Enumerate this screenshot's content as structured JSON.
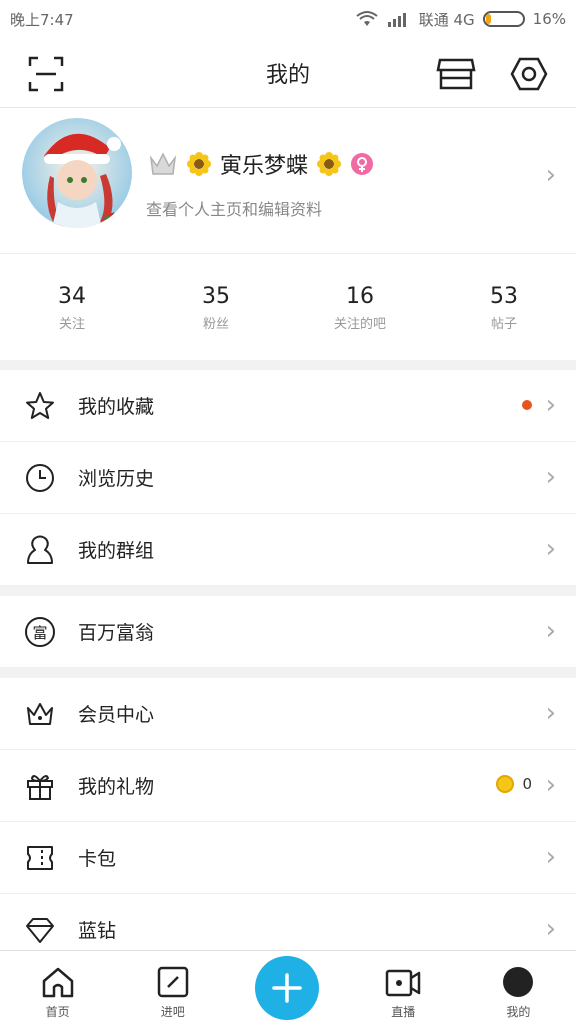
{
  "status_bar": {
    "time": "晚上7:47",
    "carrier": "联通 4G",
    "battery": "16%",
    "battery_level": 0.16
  },
  "header": {
    "title": "我的"
  },
  "profile": {
    "name": "寅乐梦蝶",
    "subtitle": "查看个人主页和编辑资料",
    "avatar_desc": "avatar-image"
  },
  "stats": [
    {
      "value": "34",
      "label": "关注"
    },
    {
      "value": "35",
      "label": "粉丝"
    },
    {
      "value": "16",
      "label": "关注的吧"
    },
    {
      "value": "53",
      "label": "帖子"
    }
  ],
  "menu": {
    "favorites": "我的收藏",
    "history": "浏览历史",
    "groups": "我的群组",
    "wealth": "百万富翁",
    "wealth_icon_text": "富",
    "vip": "会员中心",
    "gifts": "我的礼物",
    "gifts_count": "0",
    "coupons": "卡包",
    "diamond": "蓝钻"
  },
  "nav": {
    "home": "首页",
    "enter_bar": "进吧",
    "live": "直播",
    "mine": "我的"
  },
  "colors": {
    "accent": "#1fb1e6",
    "badge": "#e8541f"
  }
}
